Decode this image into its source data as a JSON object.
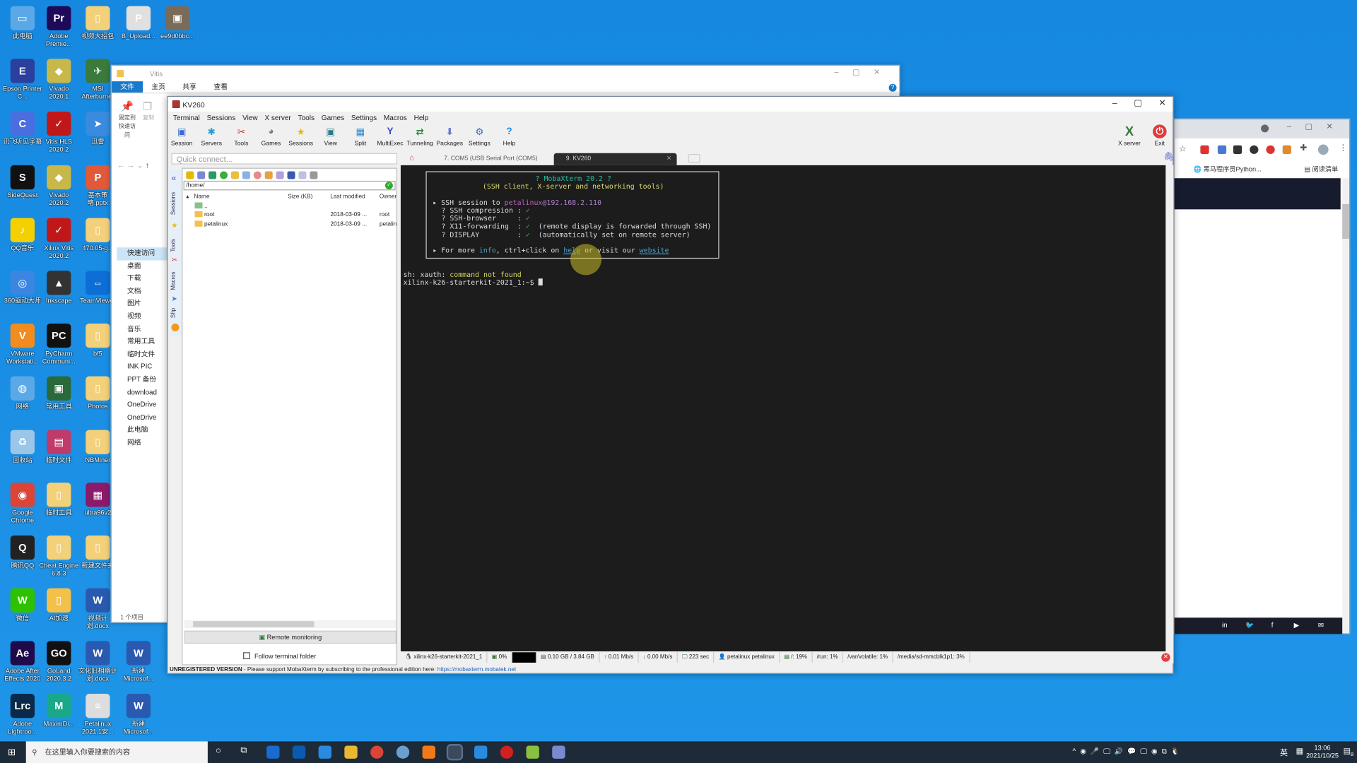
{
  "desktop": {
    "columns": [
      [
        {
          "label": "此电脑",
          "color": "#5aa9e6",
          "glyph": "▭"
        },
        {
          "label": "Epson Printer C...",
          "color": "#2a3f9e",
          "glyph": "E"
        },
        {
          "label": "讯飞听见字幕",
          "color": "#4a6ee0",
          "glyph": "C"
        },
        {
          "label": "SideQuest",
          "color": "#111",
          "glyph": "S"
        },
        {
          "label": "QQ音乐",
          "color": "#f5d000",
          "glyph": "♪"
        },
        {
          "label": "360驱动大师",
          "color": "#3b86e0",
          "glyph": "◎"
        },
        {
          "label": "VMware Workstati...",
          "color": "#f28c1e",
          "glyph": "V"
        },
        {
          "label": "网络",
          "color": "#5aa9e6",
          "glyph": "◍"
        },
        {
          "label": "回收站",
          "color": "#9cc6e8",
          "glyph": "♻"
        },
        {
          "label": "Google Chrome",
          "color": "#db4437",
          "glyph": "◉"
        },
        {
          "label": "腾讯QQ",
          "color": "#222",
          "glyph": "Q"
        },
        {
          "label": "微信",
          "color": "#2dc100",
          "glyph": "W"
        },
        {
          "label": "Adobe After Effects 2020",
          "color": "#1f0a4a",
          "glyph": "Ae"
        },
        {
          "label": "Adobe Lightroo...",
          "color": "#0a2a4a",
          "glyph": "Lrc"
        }
      ],
      [
        {
          "label": "Adobe Premie...",
          "color": "#1f0a5a",
          "glyph": "Pr"
        },
        {
          "label": "Vivado 2020.1",
          "color": "#c8b84a",
          "glyph": "◆"
        },
        {
          "label": "Vitis HLS 2020.2",
          "color": "#c01818",
          "glyph": "✓"
        },
        {
          "label": "Vivado 2020.2",
          "color": "#c8b84a",
          "glyph": "◆"
        },
        {
          "label": "Xilinx Vitis 2020.2",
          "color": "#c01818",
          "glyph": "✓"
        },
        {
          "label": "Inkscape",
          "color": "#333",
          "glyph": "▲"
        },
        {
          "label": "PyCharm Communi...",
          "color": "#111",
          "glyph": "PC"
        },
        {
          "label": "常用工具",
          "color": "#2a6a3a",
          "glyph": "▣"
        },
        {
          "label": "临时文件",
          "color": "#c03a6a",
          "glyph": "▤"
        },
        {
          "label": "临时工具",
          "color": "#f3d07a",
          "glyph": "▯"
        },
        {
          "label": "Cheat Engine 6.8.3",
          "color": "#f3d07a",
          "glyph": "▯"
        },
        {
          "label": "AI加速",
          "color": "#f3c14a",
          "glyph": "▯"
        },
        {
          "label": "GoLand 2020.3.2",
          "color": "#111",
          "glyph": "GO"
        },
        {
          "label": "MaximDi...",
          "color": "#1aa88a",
          "glyph": "M"
        }
      ],
      [
        {
          "label": "视频大招包",
          "color": "#f3d07a",
          "glyph": "▯"
        },
        {
          "label": "MSI Afterburner",
          "color": "#3a7a3a",
          "glyph": "✈"
        },
        {
          "label": "迅雷",
          "color": "#3a8ae0",
          "glyph": "➤"
        },
        {
          "label": "基本策略.pptx",
          "color": "#e05a3a",
          "glyph": "P"
        },
        {
          "label": "470.05-g...",
          "color": "#f3d07a",
          "glyph": "▯"
        },
        {
          "label": "TeamViewer",
          "color": "#0e6ed8",
          "glyph": "⇔"
        },
        {
          "label": "bf5",
          "color": "#f3d07a",
          "glyph": "▯"
        },
        {
          "label": "Photos",
          "color": "#f3d07a",
          "glyph": "▯"
        },
        {
          "label": "NBMiner",
          "color": "#f3d07a",
          "glyph": "▯"
        },
        {
          "label": "ultra96v2",
          "color": "#8a1a6a",
          "glyph": "▦"
        },
        {
          "label": "新建文件夹",
          "color": "#f3d07a",
          "glyph": "▯"
        },
        {
          "label": "视频计划.docx",
          "color": "#2a5ab0",
          "glyph": "W"
        },
        {
          "label": "文化旧相略计划.docx",
          "color": "#2a5ab0",
          "glyph": "W"
        },
        {
          "label": "Petalinux 2021.1安...",
          "color": "#ddd",
          "glyph": "≡"
        }
      ],
      [
        {
          "label": "B_Upload...",
          "color": "#e0e0e0",
          "glyph": "P"
        },
        {
          "label": ""
        },
        {
          "label": ""
        },
        {
          "label": ""
        },
        {
          "label": ""
        },
        {
          "label": ""
        },
        {
          "label": ""
        },
        {
          "label": ""
        },
        {
          "label": ""
        },
        {
          "label": ""
        },
        {
          "label": ""
        },
        {
          "label": ""
        },
        {
          "label": "新建 Microsof...",
          "color": "#2a5ab0",
          "glyph": "W"
        },
        {
          "label": "新建 Microsof...",
          "color": "#2a5ab0",
          "glyph": "W"
        }
      ],
      [
        {
          "label": "ee9d0bbc...",
          "color": "#7a6a5a",
          "glyph": "▣"
        }
      ]
    ]
  },
  "explorer": {
    "title": "Vitis",
    "ribbon_tabs": [
      "文件",
      "主页",
      "共享",
      "查看"
    ],
    "pin_label": "固定到快速访问",
    "copy_label": "复制",
    "nav": [
      "快速访问",
      "桌面",
      "下载",
      "文档",
      "图片",
      "视频",
      "音乐",
      "常用工具",
      "临时文件",
      "INK PIC",
      "PPT 备份",
      "download",
      "OneDrive",
      "OneDrive",
      "此电脑",
      "网络"
    ],
    "status": "1 个项目"
  },
  "moba": {
    "title": "KV260",
    "menu": [
      "Terminal",
      "Sessions",
      "View",
      "X server",
      "Tools",
      "Games",
      "Settings",
      "Macros",
      "Help"
    ],
    "toolbar": [
      {
        "label": "Session",
        "glyph": "▣",
        "color": "#3a6ad0"
      },
      {
        "label": "Servers",
        "glyph": "✱",
        "color": "#2a9ad0"
      },
      {
        "label": "Tools",
        "glyph": "✂",
        "color": "#d03a2a"
      },
      {
        "label": "Games",
        "glyph": "◕",
        "color": "#777"
      },
      {
        "label": "Sessions",
        "glyph": "★",
        "color": "#e8b800"
      },
      {
        "label": "View",
        "glyph": "▣",
        "color": "#2a7a8a"
      },
      {
        "label": "Split",
        "glyph": "▦",
        "color": "#2a8ad0"
      },
      {
        "label": "MultiExec",
        "glyph": "Y",
        "color": "#3a4ad0"
      },
      {
        "label": "Tunneling",
        "glyph": "⇄",
        "color": "#2a8a3a"
      },
      {
        "label": "Packages",
        "glyph": "⬇",
        "color": "#6a7ad0"
      },
      {
        "label": "Settings",
        "glyph": "⚙",
        "color": "#3a6ad0"
      },
      {
        "label": "Help",
        "glyph": "?",
        "color": "#1a8ae0"
      }
    ],
    "xserver_label": "X server",
    "exit_label": "Exit",
    "quick_connect_placeholder": "Quick connect...",
    "side_tabs": [
      "Sessions",
      "Tools",
      "Macros",
      "Sftp"
    ],
    "files": {
      "path": "/home/",
      "headers": [
        "Name",
        "Size (KB)",
        "Last modified",
        "Owner"
      ],
      "rows": [
        {
          "name": "..",
          "size": "",
          "modified": "",
          "owner": ""
        },
        {
          "name": "root",
          "size": "",
          "modified": "2018-03-09 ...",
          "owner": "root"
        },
        {
          "name": "petalinux",
          "size": "",
          "modified": "2018-03-09 ...",
          "owner": "petalinux"
        }
      ],
      "remote_monitoring": "Remote monitoring",
      "follow_folder": "Follow terminal folder",
      "follow_checked": false
    },
    "tabs": [
      {
        "label": "7. COM5  (USB Serial Port (COM5)",
        "active": false
      },
      {
        "label": "9. KV260",
        "active": true
      }
    ],
    "terminal": {
      "banner_title": "? MobaXterm 20.2 ?",
      "banner_subtitle": "(SSH client, X-server and networking tools)",
      "ssh_prefix": "▸ SSH session to ",
      "ssh_user": "petalinux",
      "ssh_host": "@192.168.2.110",
      "features": [
        {
          "name": "? SSH compression : ",
          "mark": "✓",
          "note": ""
        },
        {
          "name": "? SSH-browser     : ",
          "mark": "✓",
          "note": ""
        },
        {
          "name": "? X11-forwarding  : ",
          "mark": "✓",
          "note": "  (remote display is forwarded through SSH)"
        },
        {
          "name": "? DISPLAY         : ",
          "mark": "✓",
          "note": "  (automatically set on remote server)"
        }
      ],
      "more_prefix": "▸ For more ",
      "more_info": "info",
      "more_mid": ", ctrl+click on ",
      "more_help": "help",
      "more_or": " or visit our ",
      "more_website": "website",
      "err_prefix": "sh: xauth: ",
      "err_msg": "command not found",
      "prompt": "xilinx-k26-starterkit-2021_1:~$ "
    },
    "status": [
      "xilinx-k26-starterkit-2021_1",
      "0%",
      "",
      "0.10 GB / 3.84 GB",
      "0.01 Mb/s",
      "0.00 Mb/s",
      "223 sec",
      "petalinux  petalinux",
      "/: 19%",
      "/run: 1%",
      "/var/volatile: 1%",
      "/media/sd-mmcblk1p1: 3%"
    ],
    "unregistered": {
      "bold": "UNREGISTERED VERSION",
      "text": " - Please support MobaXterm by subscribing to the professional edition here: ",
      "link": "https://mobaxterm.mobatek.net"
    }
  },
  "browser": {
    "bookmark": "黑马程序员Python...",
    "reading_list": "阅读清单"
  },
  "taskbar": {
    "search_placeholder": "在这里输入你要搜索的内容",
    "ime": "英",
    "time": "13:06",
    "date": "2021/10/25",
    "notifications": "8"
  }
}
